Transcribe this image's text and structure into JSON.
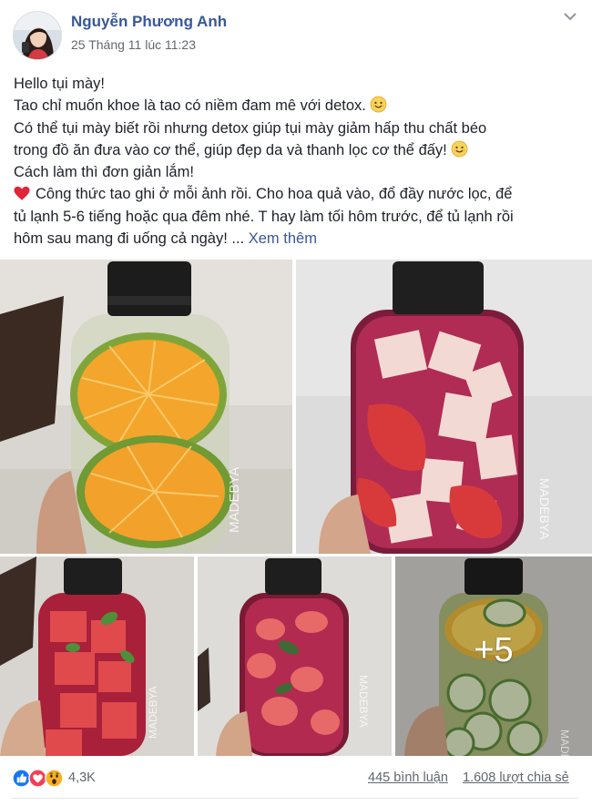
{
  "post": {
    "author": "Nguyễn Phương Anh",
    "timestamp": "25 Tháng 11 lúc 11:23",
    "menu_icon": "chevron-down-icon",
    "text_lines": [
      "Hello tụi mày!",
      "Tao chỉ muốn khoe là tao có niềm đam mê với detox.",
      "Có thể tụi mày biết rồi nhưng detox giúp tụi mày giảm hấp thu chất béo",
      "trong đồ ăn đưa vào cơ thể, giúp đẹp da và thanh lọc cơ thể đấy!",
      "Cách làm thì đơn giản lắm!",
      "Công thức tao ghi ở mỗi ảnh rồi. Cho hoa quả vào, đổ đầy nước lọc, để",
      "tủ lạnh 5-6 tiếng hoặc qua đêm nhé. T hay làm tối hôm trước, để tủ lạnh rồi",
      "hôm sau mang đi uống cả ngày! ..."
    ],
    "see_more": "Xem thêm",
    "emoji_icon": "smiling-face-emoji-icon",
    "heart_icon": "red-heart-emoji-icon"
  },
  "photos": {
    "watermark": "MADEBYA",
    "more_count": "+5",
    "items": [
      {
        "subject": "orange-lime-bottle"
      },
      {
        "subject": "strawberry-apple-bottle"
      },
      {
        "subject": "watermelon-mint-bottle"
      },
      {
        "subject": "strawberry-basil-bottle"
      },
      {
        "subject": "cucumber-lemon-bottle"
      }
    ]
  },
  "footer": {
    "reaction_icons": [
      "like-icon",
      "love-icon",
      "wow-icon"
    ],
    "reaction_count": "4,3K",
    "comments": "445 bình luận",
    "shares": "1.608 lượt chia sẻ"
  },
  "colors": {
    "link": "#385898",
    "meta": "#616770",
    "text": "#1d2129",
    "like": "#1877f2",
    "love": "#f33e58",
    "wow": "#f7b125"
  }
}
